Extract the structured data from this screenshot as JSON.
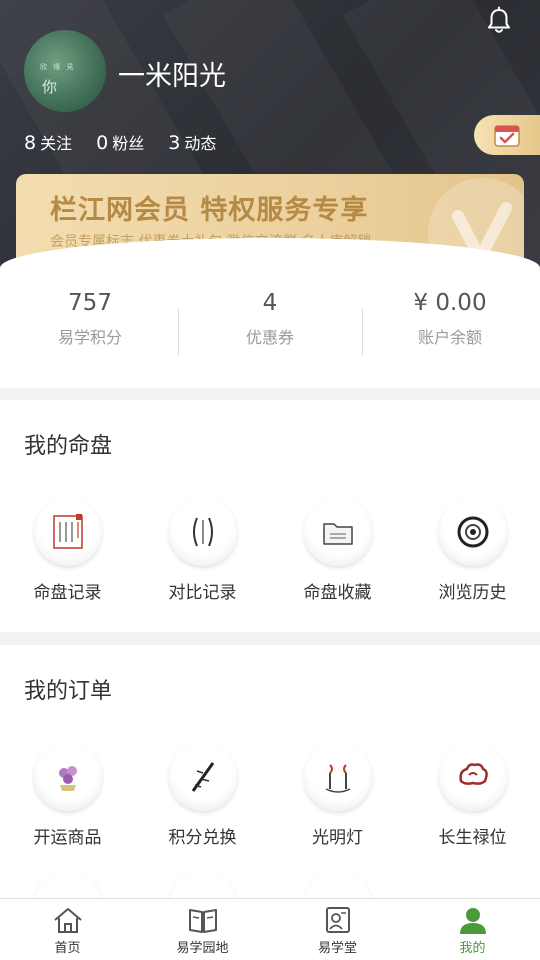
{
  "header": {
    "avatar_text_small": "欣 缘 見",
    "avatar_text_big": "你",
    "username": "一米阳光",
    "stats": [
      {
        "num": "8",
        "label": "关注"
      },
      {
        "num": "0",
        "label": "粉丝"
      },
      {
        "num": "3",
        "label": "动态"
      }
    ]
  },
  "vip": {
    "title": "栏江网会员  特权服务专享",
    "subtitle": "会员专属标志  优惠券大礼包  微信交流群  名人库解锁"
  },
  "summary": [
    {
      "value": "757",
      "label": "易学积分"
    },
    {
      "value": "4",
      "label": "优惠券"
    },
    {
      "value": "¥ 0.00",
      "label": "账户余额"
    }
  ],
  "my_charts": {
    "title": "我的命盘",
    "items": [
      {
        "label": "命盘记录",
        "icon": "chart-record-icon"
      },
      {
        "label": "对比记录",
        "icon": "compare-record-icon"
      },
      {
        "label": "命盘收藏",
        "icon": "chart-collection-icon"
      },
      {
        "label": "浏览历史",
        "icon": "browse-history-icon"
      }
    ]
  },
  "my_orders": {
    "title": "我的订单",
    "items": [
      {
        "label": "开运商品",
        "icon": "lucky-goods-icon"
      },
      {
        "label": "积分兑换",
        "icon": "points-exchange-icon"
      },
      {
        "label": "光明灯",
        "icon": "bright-lamp-icon"
      },
      {
        "label": "长生禄位",
        "icon": "longevity-tablet-icon"
      }
    ]
  },
  "tabbar": [
    {
      "label": "首页",
      "icon": "home-icon",
      "active": false
    },
    {
      "label": "易学园地",
      "icon": "book-icon",
      "active": false
    },
    {
      "label": "易学堂",
      "icon": "classroom-icon",
      "active": false
    },
    {
      "label": "我的",
      "icon": "profile-icon",
      "active": true
    }
  ],
  "colors": {
    "header_bg": "#2e3036",
    "vip_gold": "#ecd09d",
    "accent_green": "#4a9a3a"
  }
}
